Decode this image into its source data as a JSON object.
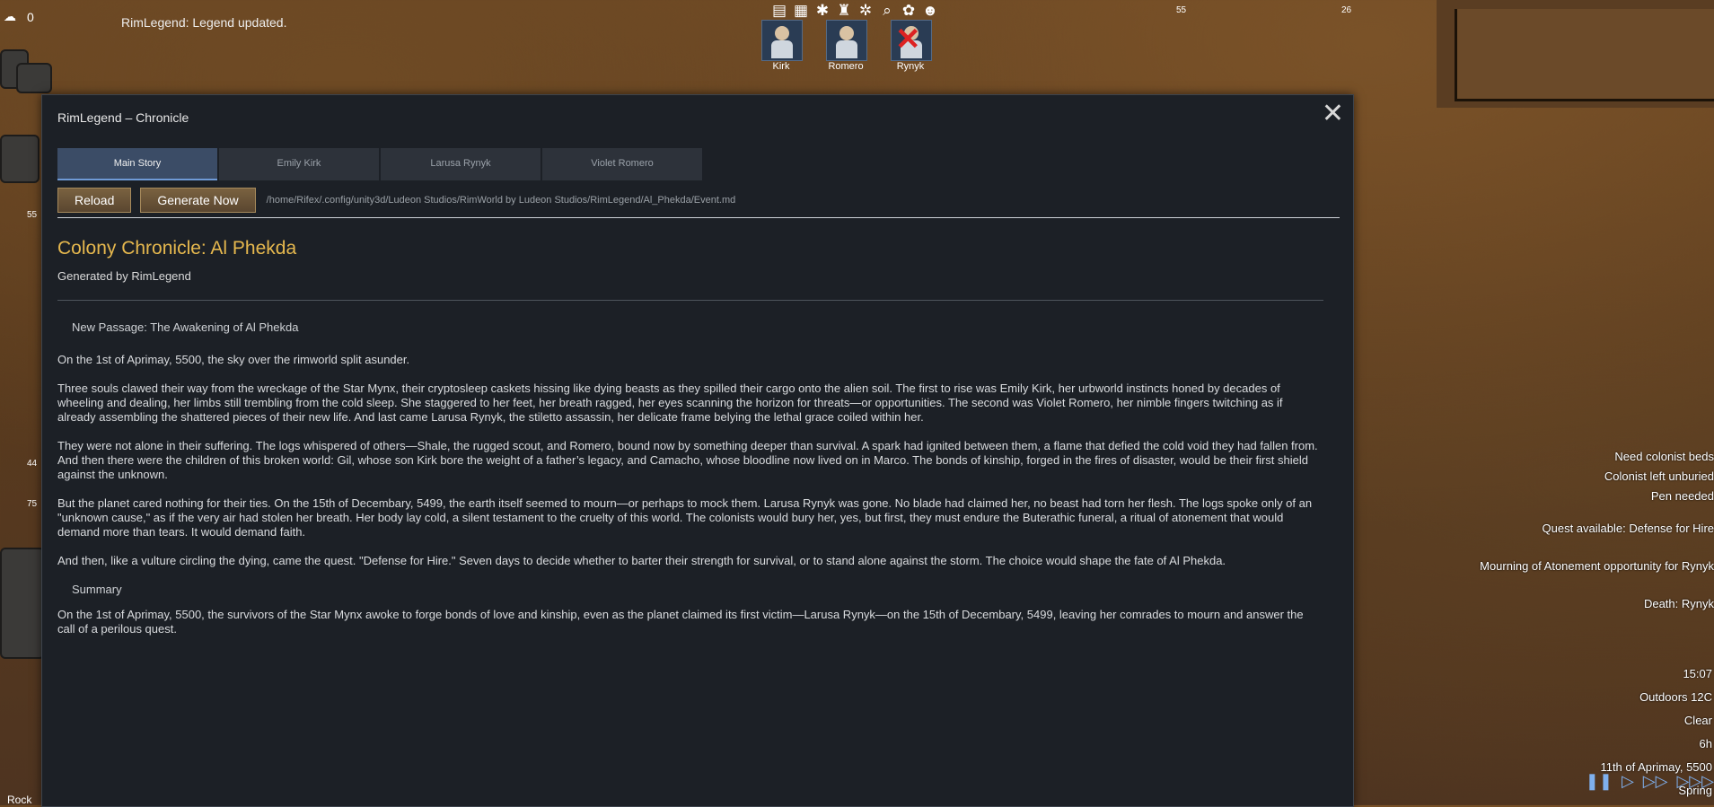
{
  "hud": {
    "resource_count": "0",
    "message": "RimLegend: Legend updated."
  },
  "toolbar_icons": [
    "list-icon",
    "grid-icon",
    "snowflake-icon",
    "chef-icon",
    "snowflake-icon",
    "search-icon",
    "palette-icon",
    "skull-icon"
  ],
  "colonists": [
    {
      "name": "Kirk",
      "dead": false
    },
    {
      "name": "Romero",
      "dead": false
    },
    {
      "name": "Rynyk",
      "dead": true
    }
  ],
  "map_numbers": {
    "a": "55",
    "b": "26",
    "c": "55",
    "d": "44",
    "e": "75"
  },
  "window": {
    "title": "RimLegend – Chronicle",
    "close_glyph": "✕",
    "tabs": [
      "Main Story",
      "Emily Kirk",
      "Larusa Rynyk",
      "Violet Romero"
    ],
    "active_tab": 0,
    "buttons": {
      "reload": "Reload",
      "generate": "Generate Now"
    },
    "file_path": "/home/Rifex/.config/unity3d/Ludeon Studios/RimWorld by Ludeon Studios/RimLegend/Al_Phekda/Event.md",
    "content": {
      "title": "Colony Chronicle: Al Phekda",
      "generated_by": "Generated by RimLegend",
      "passage_heading": "New Passage: The Awakening of Al Phekda",
      "paragraphs": [
        "On the 1st of Aprimay, 5500, the sky over the rimworld split asunder.",
        "Three souls clawed their way from the wreckage of the Star Mynx, their cryptosleep caskets hissing like dying beasts as they spilled their cargo onto the alien soil. The first to rise was Emily Kirk, her urbworld instincts honed by decades of wheeling and dealing, her limbs still trembling from the cold sleep. She staggered to her feet, her breath ragged, her eyes scanning the horizon for threats—or opportunities. The second was Violet Romero, her nimble fingers twitching as if already assembling the shattered pieces of their new life. And last came Larusa Rynyk, the stiletto assassin, her delicate frame belying the lethal grace coiled within her.",
        "They were not alone in their suffering. The logs whispered of others—Shale, the rugged scout, and Romero, bound now by something deeper than survival. A spark had ignited between them, a flame that defied the cold void they had fallen from. And then there were the children of this broken world: Gil, whose son Kirk bore the weight of a father’s legacy, and Camacho, whose bloodline now lived on in Marco. The bonds of kinship, forged in the fires of disaster, would be their first shield against the unknown.",
        "But the planet cared nothing for their ties. On the 15th of Decembary, 5499, the earth itself seemed to mourn—or perhaps to mock them. Larusa Rynyk was gone. No blade had claimed her, no beast had torn her flesh. The logs spoke only of an \"unknown cause,\" as if the very air had stolen her breath. Her body lay cold, a silent testament to the cruelty of this world. The colonists would bury her, yes, but first, they must endure the Buterathic funeral, a ritual of atonement that would demand more than tears. It would demand faith.",
        "And then, like a vulture circling the dying, came the quest. \"Defense for Hire.\" Seven days to decide whether to barter their strength for survival, or to stand alone against the storm. The choice would shape the fate of Al Phekda."
      ],
      "summary_heading": "Summary",
      "summary": "On the 1st of Aprimay, 5500, the survivors of the Star Mynx awoke to forge bonds of love and kinship, even as the planet claimed its first victim—Larusa Rynyk—on the 15th of Decembary, 5499, leaving her comrades to mourn and answer the call of a perilous quest."
    }
  },
  "alerts": [
    "Need colonist beds",
    "Colonist left unburied",
    "Pen needed",
    "Quest available: Defense for Hire",
    "Mourning of Atonement opportunity for Rynyk",
    "Death: Rynyk"
  ],
  "info": {
    "time": "15:07",
    "temperature": "Outdoors 12C",
    "weather": "Clear",
    "hours": "6h",
    "date": "11th of Aprimay, 5500",
    "season": "Spring"
  },
  "speed_controls": [
    "pause-icon",
    "normal-speed-icon",
    "fast-speed-icon",
    "superfast-speed-icon"
  ],
  "bottom_left_label": "Rock",
  "colors": {
    "accent_title": "#e6b84e",
    "tab_active": "#3b4c66",
    "button": "#6a5238"
  }
}
